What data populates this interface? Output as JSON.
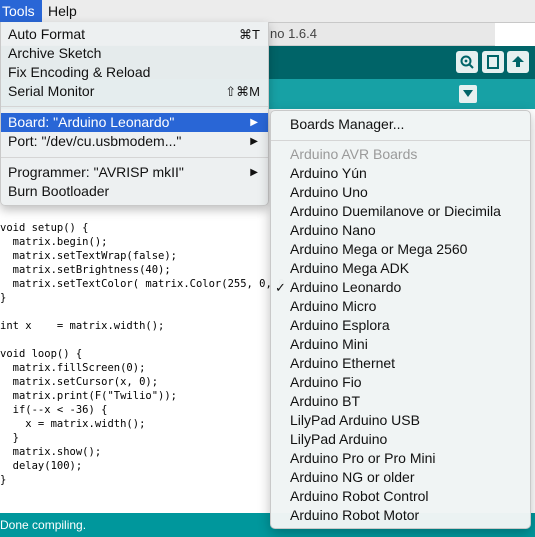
{
  "menubar": {
    "tools": "Tools",
    "help": "Help"
  },
  "window": {
    "title_fragment": "no 1.6.4"
  },
  "tools_menu": {
    "auto_format": "Auto Format",
    "auto_format_shortcut": "⌘T",
    "archive_sketch": "Archive Sketch",
    "fix_encoding": "Fix Encoding & Reload",
    "serial_monitor": "Serial Monitor",
    "serial_monitor_shortcut": "⇧⌘M",
    "board": "Board: \"Arduino Leonardo\"",
    "port": "Port: \"/dev/cu.usbmodem...\"",
    "programmer": "Programmer: \"AVRISP mkII\"",
    "burn_bootloader": "Burn Bootloader",
    "submenu_arrow": "▶"
  },
  "board_menu": {
    "boards_manager": "Boards Manager...",
    "section_header": "Arduino AVR Boards",
    "checkmark": "✓",
    "boards": [
      "Arduino Yún",
      "Arduino Uno",
      "Arduino Duemilanove or Diecimila",
      "Arduino Nano",
      "Arduino Mega or Mega 2560",
      "Arduino Mega ADK",
      "Arduino Leonardo",
      "Arduino Micro",
      "Arduino Esplora",
      "Arduino Mini",
      "Arduino Ethernet",
      "Arduino Fio",
      "Arduino BT",
      "LilyPad Arduino USB",
      "LilyPad Arduino",
      "Arduino Pro or Pro Mini",
      "Arduino NG or older",
      "Arduino Robot Control",
      "Arduino Robot Motor"
    ],
    "selected_index": 6
  },
  "editor": {
    "lines": [
      {
        "t": "void setup() {"
      },
      {
        "t": "  matrix.begin();"
      },
      {
        "t": "  matrix.setTextWrap(false);"
      },
      {
        "t": "  matrix.setBrightness(40);"
      },
      {
        "t": "  matrix.setTextColor( matrix.Color(255, 0, 0"
      },
      {
        "t": "}"
      },
      {
        "t": ""
      },
      {
        "t": "int x    = matrix.width();"
      },
      {
        "t": ""
      },
      {
        "t": "void loop() {"
      },
      {
        "t": "  matrix.fillScreen(0);"
      },
      {
        "t": "  matrix.setCursor(x, 0);"
      },
      {
        "t": "  matrix.print(F(\"Twilio\"));"
      },
      {
        "t": "  if(--x < -36) {"
      },
      {
        "t": "    x = matrix.width();"
      },
      {
        "t": "  }"
      },
      {
        "t": "  matrix.show();"
      },
      {
        "t": "  delay(100);"
      },
      {
        "t": "}"
      }
    ]
  },
  "status": {
    "text": "Done compiling."
  },
  "colors": {
    "highlight": "#2966d6",
    "toolbar": "#006468",
    "tabbar": "#17a1a5",
    "status": "#00979c"
  }
}
